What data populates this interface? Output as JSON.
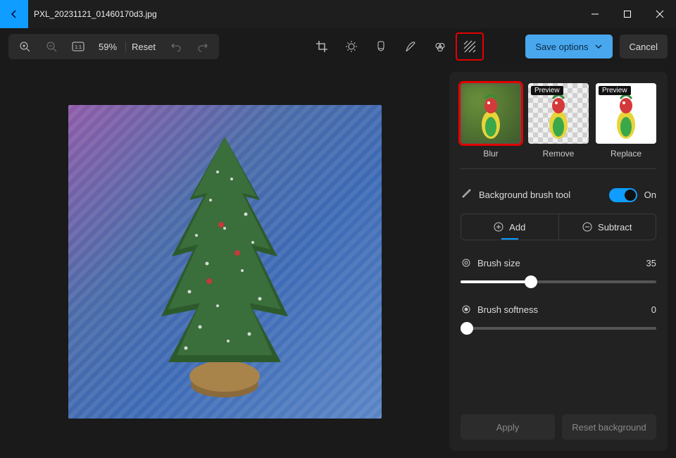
{
  "window": {
    "title": "PXL_20231121_01460170d3.jpg"
  },
  "zoom": {
    "level": "59%",
    "reset": "Reset"
  },
  "actions": {
    "save": "Save options",
    "cancel": "Cancel"
  },
  "tools": [
    "crop",
    "brightness",
    "filter",
    "markup",
    "retouch",
    "background"
  ],
  "panel": {
    "bg_options": [
      {
        "label": "Blur",
        "selected": true,
        "preview_tag": false
      },
      {
        "label": "Remove",
        "selected": false,
        "preview_tag": true
      },
      {
        "label": "Replace",
        "selected": false,
        "preview_tag": true
      }
    ],
    "preview_tag_text": "Preview",
    "brush_tool_label": "Background brush tool",
    "toggle_state": "On",
    "tabs": {
      "add": "Add",
      "subtract": "Subtract"
    },
    "brush_size": {
      "label": "Brush size",
      "value": 35,
      "min": 0,
      "max": 100
    },
    "brush_softness": {
      "label": "Brush softness",
      "value": 0,
      "min": 0,
      "max": 100
    },
    "apply": "Apply",
    "reset_bg": "Reset background"
  }
}
